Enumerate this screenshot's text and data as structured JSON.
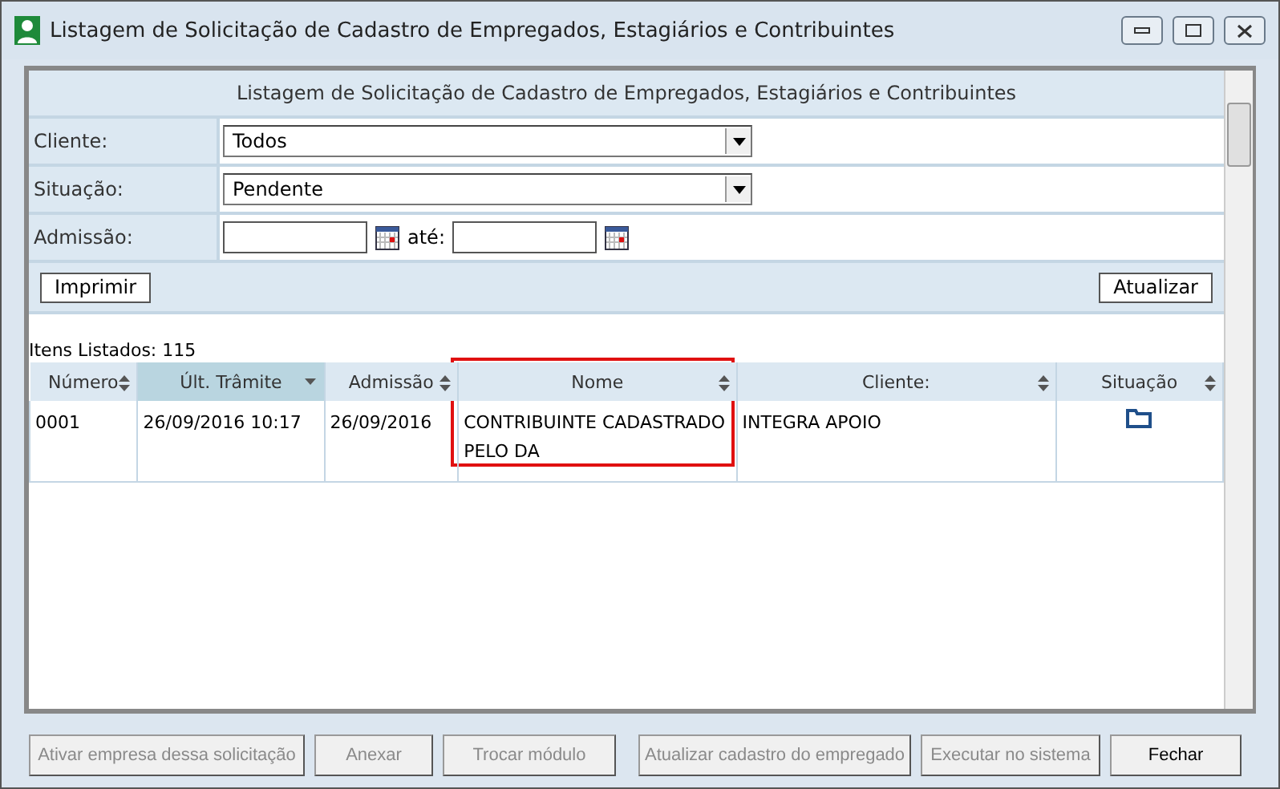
{
  "window": {
    "title": "Listagem de Solicitação de Cadastro de Empregados, Estagiários e Contribuintes"
  },
  "panel_title": "Listagem de Solicitação de Cadastro de Empregados, Estagiários e Contribuintes",
  "filters": [
    {
      "kind": "select",
      "label": "Cliente:",
      "value": "Todos"
    },
    {
      "kind": "select",
      "label": "Situação:",
      "value": "Pendente"
    },
    {
      "kind": "daterange",
      "label": "Admissão:",
      "separator": "até:"
    }
  ],
  "print_button": "Imprimir",
  "refresh_button": "Atualizar",
  "count_label": "Itens Listados: 115",
  "table": {
    "columns": [
      {
        "label": "Número",
        "sorted": false
      },
      {
        "label": "Últ. Trâmite",
        "sorted": true
      },
      {
        "label": "Admissão",
        "sorted": false
      },
      {
        "label": "Nome",
        "sorted": false,
        "highlighted": true
      },
      {
        "label": "Cliente:",
        "sorted": false
      },
      {
        "label": "Situação",
        "sorted": false
      }
    ],
    "rows": [
      {
        "cells": [
          "0001",
          "26/09/2016 10:17",
          "26/09/2016",
          "CONTRIBUINTE CADASTRADO PELO DA",
          "INTEGRA APOIO"
        ]
      }
    ]
  },
  "buttons": [
    {
      "label": "Ativar empresa dessa solicitação",
      "disabled": true
    },
    {
      "label": "Anexar",
      "disabled": true
    },
    {
      "label": "Trocar módulo",
      "disabled": true
    },
    {
      "label": "Atualizar cadastro do empregado",
      "disabled": true
    },
    {
      "label": "Executar no sistema",
      "disabled": true
    },
    {
      "label": "Fechar",
      "disabled": false
    }
  ]
}
